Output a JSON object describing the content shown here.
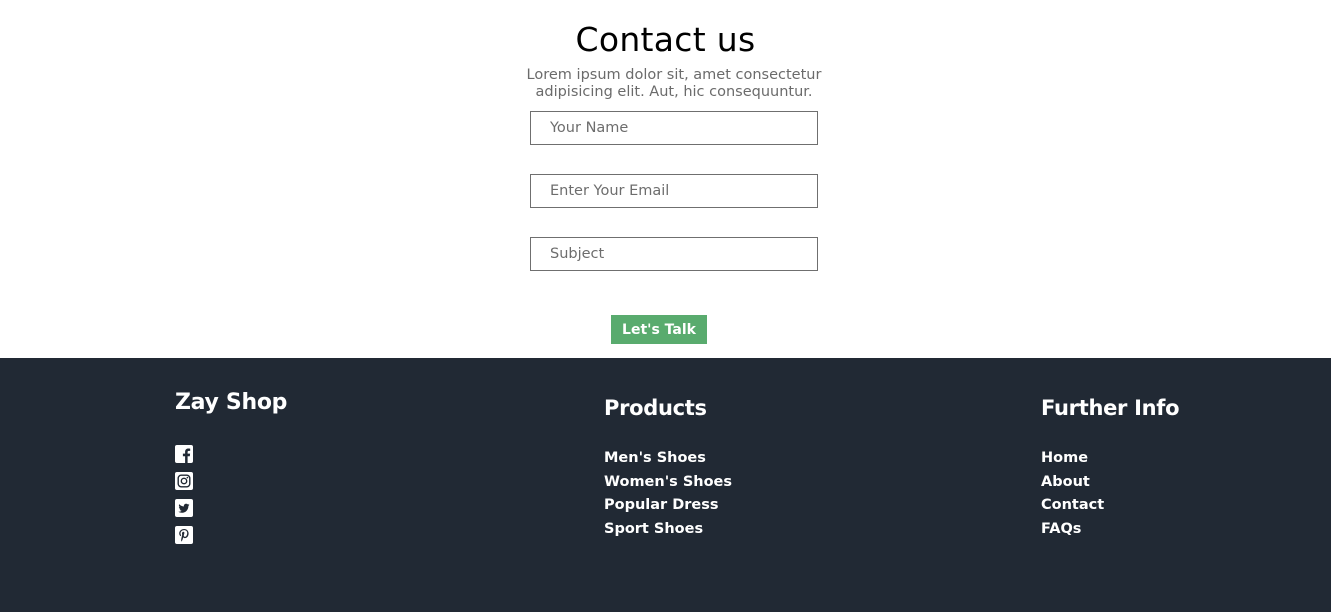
{
  "contact": {
    "title": "Contact us",
    "description": "Lorem ipsum dolor sit, amet consectetur adipisicing elit. Aut, hic consequuntur.",
    "fields": {
      "name_placeholder": "Your Name",
      "email_placeholder": "Enter Your Email",
      "subject_placeholder": "Subject"
    },
    "submit_label": "Let's Talk",
    "button_color": "#59ab6e"
  },
  "footer": {
    "background": "#212934",
    "brand": "Zay Shop",
    "social_icons": [
      "facebook-icon",
      "instagram-icon",
      "twitter-icon",
      "pinterest-icon"
    ],
    "products": {
      "title": "Products",
      "items": [
        "Men's Shoes",
        "Women's Shoes",
        "Popular Dress",
        "Sport Shoes"
      ]
    },
    "further_info": {
      "title": "Further Info",
      "items": [
        "Home",
        "About",
        "Contact",
        "FAQs"
      ]
    }
  }
}
